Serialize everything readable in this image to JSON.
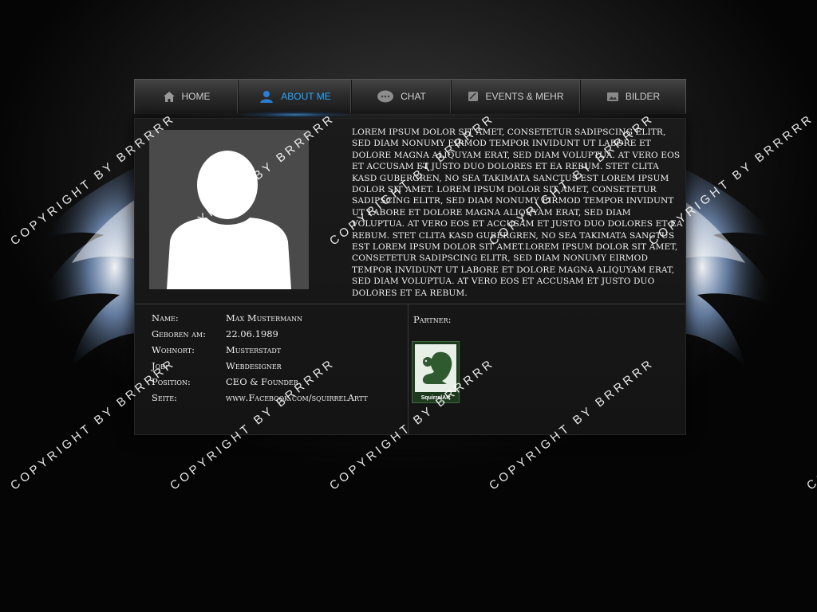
{
  "nav": {
    "items": [
      {
        "label": "Home",
        "icon": "home-icon"
      },
      {
        "label": "About me",
        "icon": "user-icon"
      },
      {
        "label": "Chat",
        "icon": "chat-bubble-icon"
      },
      {
        "label": "Events & Mehr",
        "icon": "calendar-icon"
      },
      {
        "label": "Bilder",
        "icon": "picture-icon"
      }
    ],
    "active_index": 1,
    "active_color": "#2aa8ff"
  },
  "profile": {
    "bio": "Lorem ipsum dolor sit amet, consetetur sadipscing elitr, sed diam nonumy eirmod tempor invidunt ut labore et dolore magna aliquyam erat, sed diam voluptua. At vero eos et accusam et justo duo dolores et ea rebum. Stet clita kasd gubergren, no sea takimata sanctus est Lorem ipsum dolor sit amet. Lorem ipsum dolor sit amet, consetetur sadipscing elitr, sed diam nonumy eirmod tempor invidunt ut labore et dolore magna aliquyam erat, sed diam voluptua. At vero eos et accusam et justo duo dolores et ea rebum. Stet clita kasd gubergren, no sea takimata sanctus est Lorem ipsum dolor sit amet.Lorem ipsum dolor sit amet, consetetur sadipscing elitr, sed diam nonumy eirmod tempor invidunt ut labore et dolore magna aliquyam erat, sed diam voluptua. At vero eos et accusam et justo duo dolores et ea rebum.",
    "info": [
      {
        "key": "Name:",
        "value": "Max Mustermann"
      },
      {
        "key": "Geboren am:",
        "value": "22.06.1989"
      },
      {
        "key": "Wohnort:",
        "value": "Musterstadt"
      },
      {
        "key": "Job:",
        "value": "Webdesigner"
      },
      {
        "key": "Position:",
        "value": "CEO & Founder"
      },
      {
        "key": "Seite:",
        "value": "www.Facebook.com/squirrelArtt"
      }
    ],
    "partner_label": "Partner:",
    "partner_logo_text": "SquirrelArt"
  },
  "watermark": "COPYRIGHT BY BRRRRR"
}
